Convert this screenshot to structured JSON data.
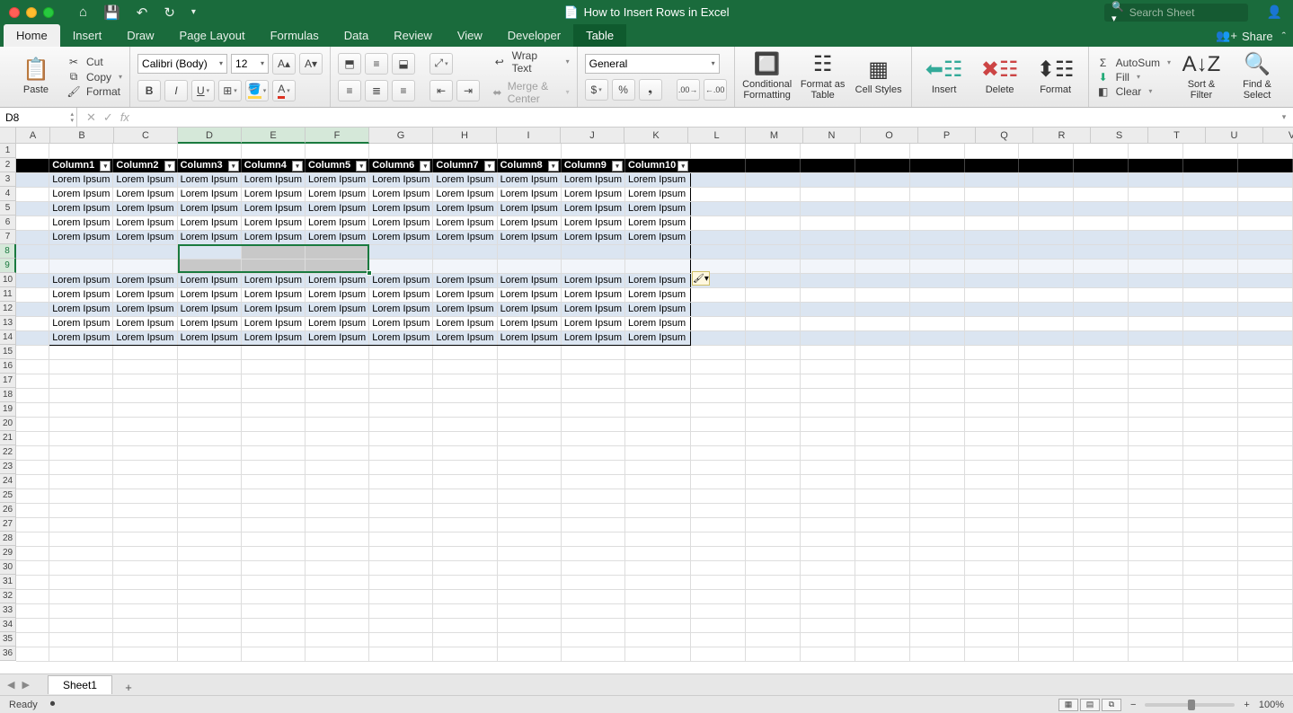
{
  "title_bar": {
    "document_title": "How to Insert Rows in Excel",
    "search_placeholder": "Search Sheet"
  },
  "ribbon_tabs": [
    "Home",
    "Insert",
    "Draw",
    "Page Layout",
    "Formulas",
    "Data",
    "Review",
    "View",
    "Developer",
    "Table"
  ],
  "ribbon_right": {
    "share": "Share"
  },
  "clipboard": {
    "paste": "Paste",
    "cut": "Cut",
    "copy": "Copy",
    "format_painter": "Format"
  },
  "font": {
    "name": "Calibri (Body)",
    "size": "12"
  },
  "alignment": {
    "wrap": "Wrap Text",
    "merge": "Merge & Center"
  },
  "number": {
    "format": "General"
  },
  "styles": {
    "cond": "Conditional Formatting",
    "table": "Format as Table",
    "cell": "Cell Styles"
  },
  "cells_group": {
    "insert": "Insert",
    "delete": "Delete",
    "format": "Format"
  },
  "editing": {
    "autosum": "AutoSum",
    "fill": "Fill",
    "clear": "Clear",
    "sort": "Sort & Filter",
    "find": "Find & Select"
  },
  "name_box": "D8",
  "columns": [
    "A",
    "B",
    "C",
    "D",
    "E",
    "F",
    "G",
    "H",
    "I",
    "J",
    "K",
    "L",
    "M",
    "N",
    "O",
    "P",
    "Q",
    "R",
    "S",
    "T",
    "U",
    "V"
  ],
  "rows": [
    "1",
    "2",
    "3",
    "4",
    "5",
    "6",
    "7",
    "8",
    "9",
    "10",
    "11",
    "12",
    "13",
    "14",
    "15",
    "16",
    "17",
    "18",
    "19",
    "20",
    "21",
    "22",
    "23",
    "24",
    "25",
    "26",
    "27",
    "28",
    "29",
    "30",
    "31",
    "32",
    "33",
    "34",
    "35",
    "36"
  ],
  "table": {
    "headers": [
      "Column1",
      "Column2",
      "Column3",
      "Column4",
      "Column5",
      "Column6",
      "Column7",
      "Column8",
      "Column9",
      "Column10"
    ],
    "cell_value": "Lorem Ipsum"
  },
  "sheet": {
    "name": "Sheet1"
  },
  "status": {
    "ready": "Ready",
    "zoom": "100%"
  }
}
